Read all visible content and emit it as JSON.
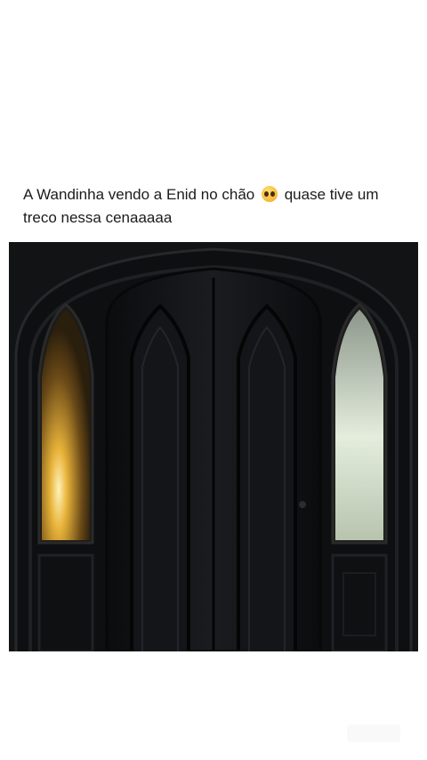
{
  "post": {
    "caption_line1_start": "A Wandinha vendo a Enid no chão",
    "caption_emoji": "pleading-face-emoji",
    "caption_line1_end": "quase tive um",
    "caption_line2": "treco nessa cenaaaaa"
  },
  "media": {
    "type": "video-frame",
    "description_icon": "gothic-door-scene",
    "colors": {
      "background": "#101113",
      "left_window_glow": "#e8b33a",
      "right_window_glow": "#dfe8d9"
    }
  }
}
